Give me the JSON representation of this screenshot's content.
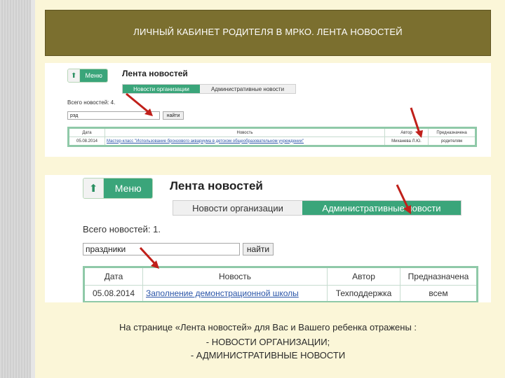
{
  "slide": {
    "title": "ЛИЧНЫЙ КАБИНЕТ РОДИТЕЛЯ  В МРКО. ЛЕНТА НОВОСТЕЙ",
    "caption_lines": [
      "На странице «Лента новостей» для Вас и Вашего ребенка отражены :",
      "- НОВОСТИ ОРГАНИЗАЦИИ;",
      "- АДМИНИСТРАТИВНЫЕ НОВОСТИ"
    ],
    "arrow_color": "#c0201a",
    "banner_color": "#7b6f2f",
    "accent_green": "#3aa57a"
  },
  "screenshot1": {
    "menu_label": "Меню",
    "home_icon": "home-arrow-icon",
    "page_title": "Лента новостей",
    "tabs": [
      "Новости организации",
      "Административные новости"
    ],
    "active_tab": 0,
    "total_text": "Всего новостей: 4.",
    "search_value": "рэд",
    "search_button": "найти",
    "table": {
      "headers": [
        "Дата",
        "Новость",
        "Автор",
        "Предназначена"
      ],
      "rows": [
        [
          "05.08.2014",
          "Мастер-класс \"Использование бронзового аквариума в детском общеобразовательном учреждении\"",
          "Миханева Л.Ю.",
          "родителям"
        ]
      ]
    }
  },
  "screenshot2": {
    "menu_label": "Меню",
    "home_icon": "home-arrow-icon",
    "page_title": "Лента новостей",
    "tabs": [
      "Новости организации",
      "Административные новости"
    ],
    "active_tab": 1,
    "total_text": "Всего новостей: 1.",
    "search_value": "праздники",
    "search_button": "найти",
    "table": {
      "headers": [
        "Дата",
        "Новость",
        "Автор",
        "Предназначена"
      ],
      "rows": [
        [
          "05.08.2014",
          "Заполнение демонстрационной школы",
          "Техподдержка",
          "всем"
        ]
      ]
    }
  }
}
